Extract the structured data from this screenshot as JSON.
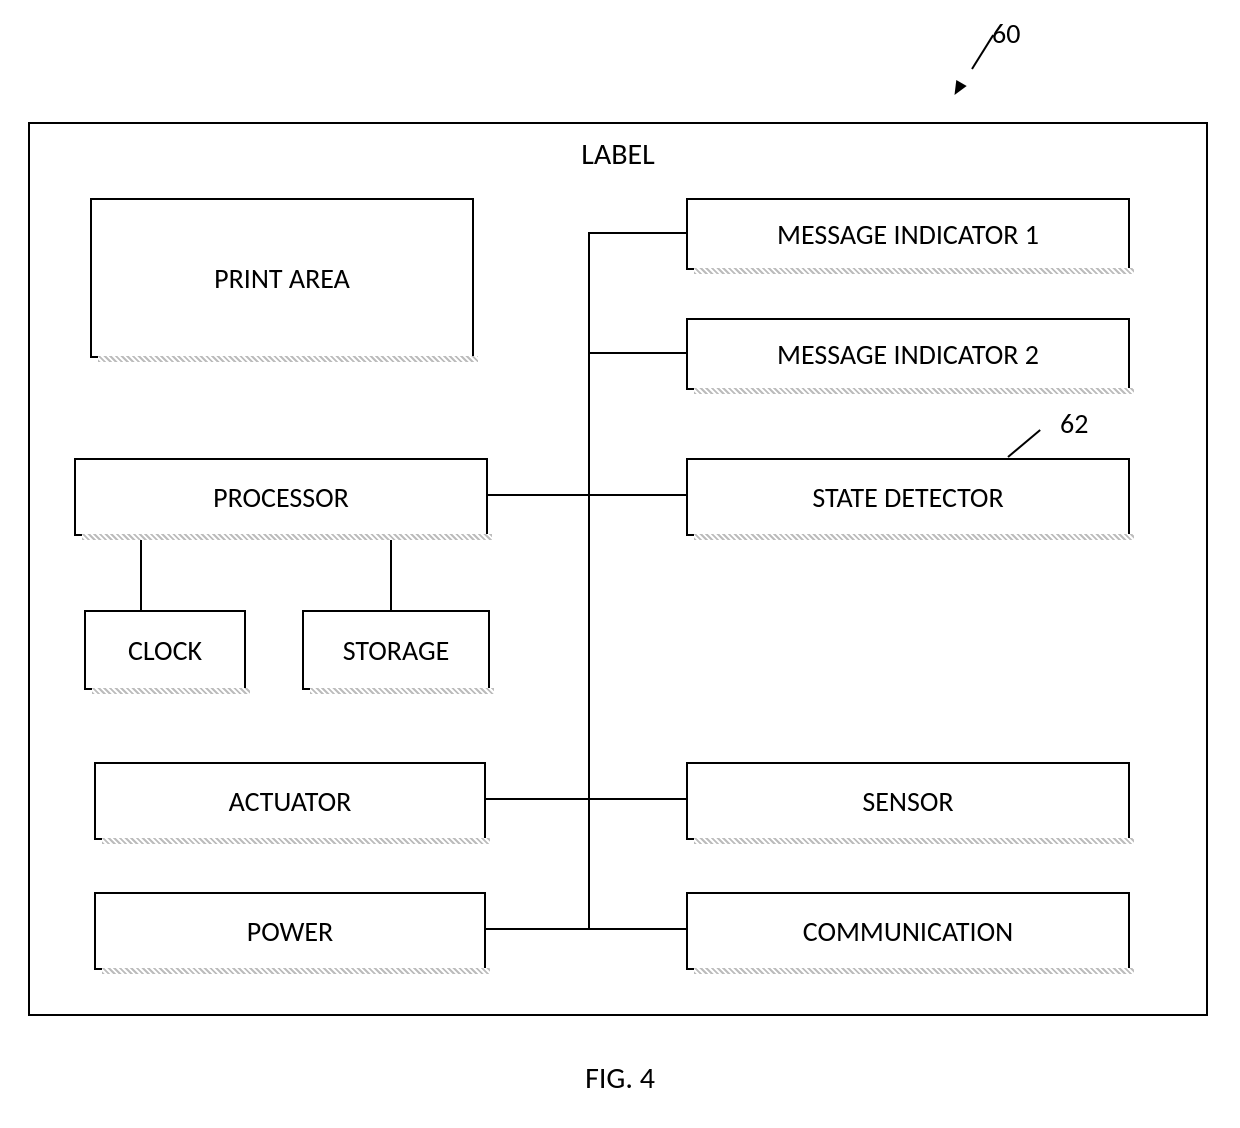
{
  "figure_caption": "FIG. 4",
  "refs": {
    "outer": "60",
    "state_detector": "62"
  },
  "outer": {
    "title": "LABEL"
  },
  "blocks": {
    "print_area": "PRINT AREA",
    "processor": "PROCESSOR",
    "clock": "CLOCK",
    "storage": "STORAGE",
    "actuator": "ACTUATOR",
    "power": "POWER",
    "msg1": "MESSAGE INDICATOR 1",
    "msg2": "MESSAGE INDICATOR 2",
    "state_detector": "STATE DETECTOR",
    "sensor": "SENSOR",
    "communication": "COMMUNICATION"
  }
}
